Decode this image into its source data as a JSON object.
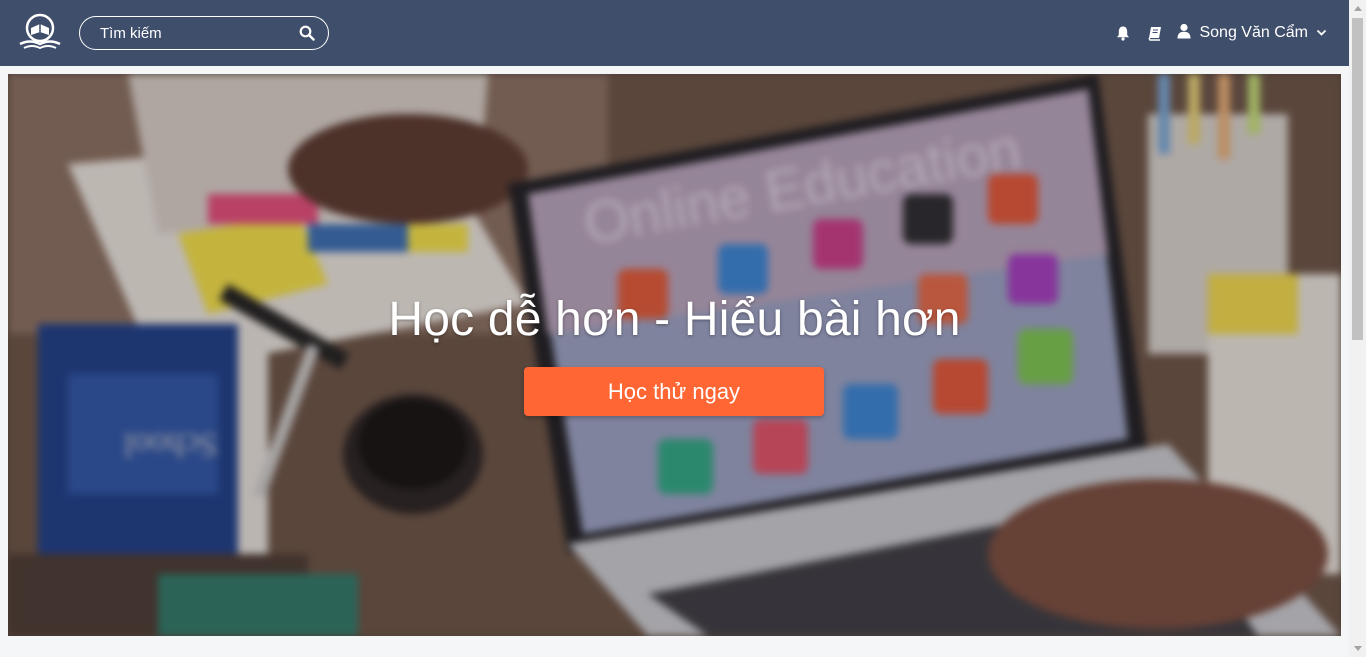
{
  "header": {
    "logo_icon": "open-book-logo",
    "search": {
      "placeholder": "Tìm kiếm",
      "value": "",
      "icon": "search-icon"
    },
    "notifications_icon": "bell-icon",
    "courses_icon": "book-icon",
    "user": {
      "icon": "user-icon",
      "name": "Song Văn Cẩm",
      "dropdown_icon": "chevron-down-icon"
    }
  },
  "hero": {
    "title": "Học dễ hơn - Hiểu bài hơn",
    "cta_label": "Học thử ngay",
    "background_text": "Online Education",
    "book_text": "School"
  },
  "colors": {
    "header_bg": "#3f4e6b",
    "cta_bg": "#ff6633",
    "page_bg": "#f5f6f8"
  }
}
